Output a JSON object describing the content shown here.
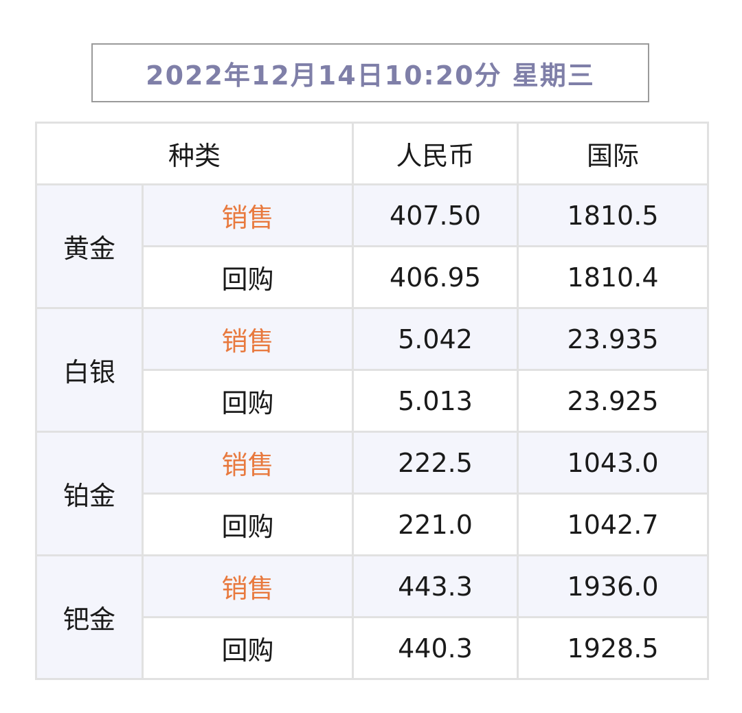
{
  "datetime": "2022年12月14日10:20分 星期三",
  "table": {
    "headers": {
      "category": "种类",
      "rmb": "人民币",
      "intl": "国际"
    },
    "rows": [
      {
        "metal": "黄金",
        "sale": {
          "label": "销售",
          "rmb": "407.50",
          "intl": "1810.5"
        },
        "buy": {
          "label": "回购",
          "rmb": "406.95",
          "intl": "1810.4"
        }
      },
      {
        "metal": "白银",
        "sale": {
          "label": "销售",
          "rmb": "5.042",
          "intl": "23.935"
        },
        "buy": {
          "label": "回购",
          "rmb": "5.013",
          "intl": "23.925"
        }
      },
      {
        "metal": "铂金",
        "sale": {
          "label": "销售",
          "rmb": "222.5",
          "intl": "1043.0"
        },
        "buy": {
          "label": "回购",
          "rmb": "221.0",
          "intl": "1042.7"
        }
      },
      {
        "metal": "钯金",
        "sale": {
          "label": "销售",
          "rmb": "443.3",
          "intl": "1936.0"
        },
        "buy": {
          "label": "回购",
          "rmb": "440.3",
          "intl": "1928.5"
        }
      }
    ]
  },
  "colors": {
    "date_text": "#7f7fa8",
    "sale_label": "#e8793e",
    "row_tint": "#f4f5fc",
    "border": "#e1e1e1"
  }
}
